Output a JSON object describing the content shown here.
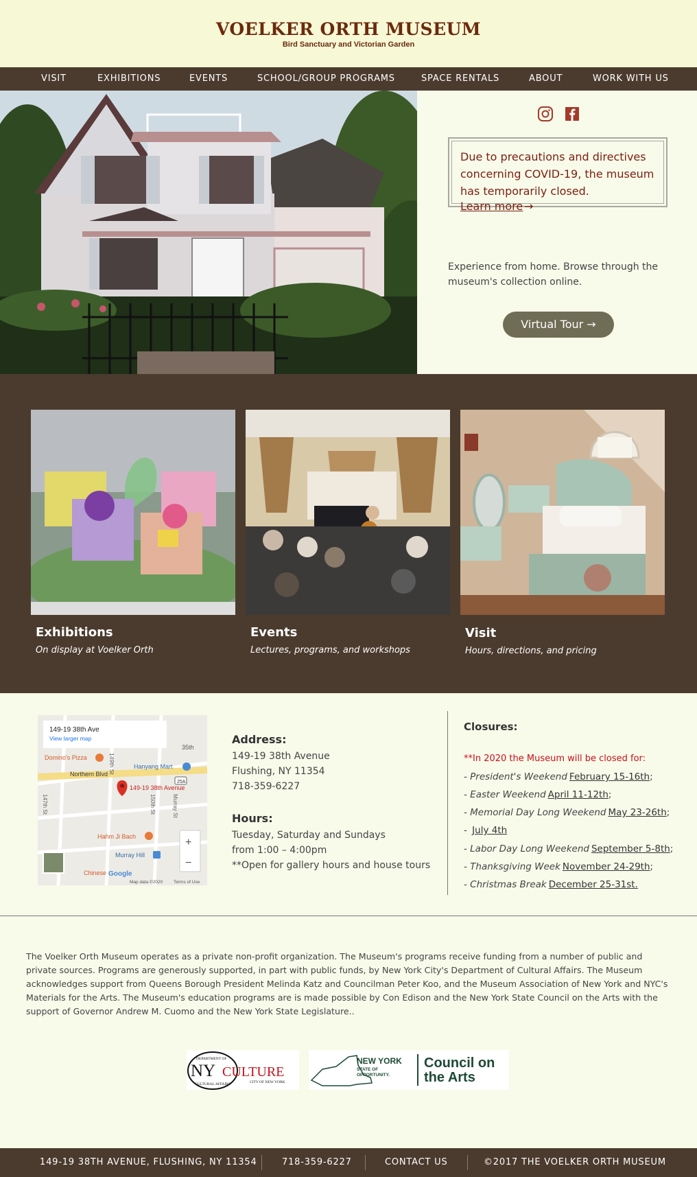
{
  "header": {
    "title": "VOELKER ORTH MUSEUM",
    "subtitle": "Bird Sanctuary and Victorian Garden"
  },
  "nav": {
    "items": [
      "VISIT",
      "EXHIBITIONS",
      "EVENTS",
      "SCHOOL/GROUP PROGRAMS",
      "SPACE RENTALS",
      "ABOUT",
      "WORK WITH US"
    ]
  },
  "social": {
    "icons": [
      "instagram-icon",
      "facebook-icon"
    ]
  },
  "notice": {
    "text": "Due to precautions and directives concerning COVID-19, the museum has temporarily closed.",
    "link": "Learn more",
    "arrow": "→"
  },
  "virtual": {
    "text": "Experience from home. Browse through the museum's collection online.",
    "button": "Virtual Tour →"
  },
  "cards": [
    {
      "title": "Exhibitions",
      "subtitle": "On display at Voelker Orth"
    },
    {
      "title": "Events",
      "subtitle": "Lectures, programs, and workshops"
    },
    {
      "title": "Visit",
      "subtitle": "Hours, directions, and pricing"
    }
  ],
  "map": {
    "place": "149-19 38th Ave",
    "larger": "View larger map",
    "marker": "149-19 38th Avenue",
    "labels": [
      "Domino's Pizza",
      "Hanyang Mart",
      "Northern Blvd",
      "Hahm Ji Bach",
      "Murray Hill",
      "Chinese",
      "35th",
      "149th St",
      "150th St",
      "Murray St",
      "147th St"
    ],
    "attribution": "Map data ©2020",
    "terms": "Terms of Use",
    "google": "Google",
    "zoom_in": "+",
    "zoom_out": "−",
    "route": "25A"
  },
  "address": {
    "heading": "Address:",
    "lines": [
      "149-19 38th Avenue",
      "Flushing, NY 11354",
      "718-359-6227"
    ]
  },
  "hours": {
    "heading": "Hours:",
    "lines": [
      "Tuesday, Saturday and Sundays",
      "from 1:00 – 4:00pm",
      "**Open for gallery hours and house tours"
    ]
  },
  "closures": {
    "heading": "Closures:",
    "note": "**In 2020 the Museum will be closed for:",
    "items": [
      {
        "label": "- President's Weekend",
        "date": "February 15-16th",
        "tail": ";"
      },
      {
        "label": "- Easter Weekend",
        "date": "April 11-12th",
        "tail": ";"
      },
      {
        "label": "- Memorial Day Long Weekend",
        "date": "May 23-26th",
        "tail": ";"
      },
      {
        "label": "- ",
        "date": "July 4th",
        "tail": ""
      },
      {
        "label": "- Labor Day Long Weekend",
        "date": "September 5-8th",
        "tail": ";"
      },
      {
        "label": "- Thanksgiving Week",
        "date": "November 24-29th",
        "tail": ";"
      },
      {
        "label": "- Christmas Break",
        "date": "December 25-31st.",
        "tail": ""
      }
    ]
  },
  "about": {
    "text": "The Voelker Orth Museum operates as a private non-profit organization. The Museum's programs receive funding from a number of public and private sources. Programs are generously supported, in part with public funds, by New York City's Department of Cultural Affairs. The Museum acknowledges support from Queens Borough President Melinda Katz and Councilman Peter Koo, and the Museum Association of New York and NYC's Materials for the Arts. The Museum's education programs are is made possible by Con Edison and the New York State Council on the Arts with the support of Governor Andrew M. Cuomo and the New York State Legislature.."
  },
  "logos": {
    "nyc_ring_top": "DEPARTMENT OF",
    "nyc_ring_bottom": "CULTURAL AFFAIRS",
    "nyc_ny": "NY",
    "nyc_culture": "CULTURE",
    "nyc_city": "CITY OF NEW YORK",
    "nys_title": "NEW YORK",
    "nys_sub1": "STATE OF",
    "nys_sub2": "OPPORTUNITY.",
    "council_1": "Council on",
    "council_2": "the Arts"
  },
  "footer": {
    "address": "149-19 38TH AVENUE, FLUSHING, NY 11354",
    "phone": "718-359-6227",
    "contact": "CONTACT US",
    "copyright": "©2017 THE VOELKER ORTH MUSEUM"
  },
  "colors": {
    "brown": "#4b3b2e",
    "maroon": "#7b1f0e",
    "cream": "#f8faea",
    "header": "#f7f8d6",
    "red": "#c8101a"
  }
}
